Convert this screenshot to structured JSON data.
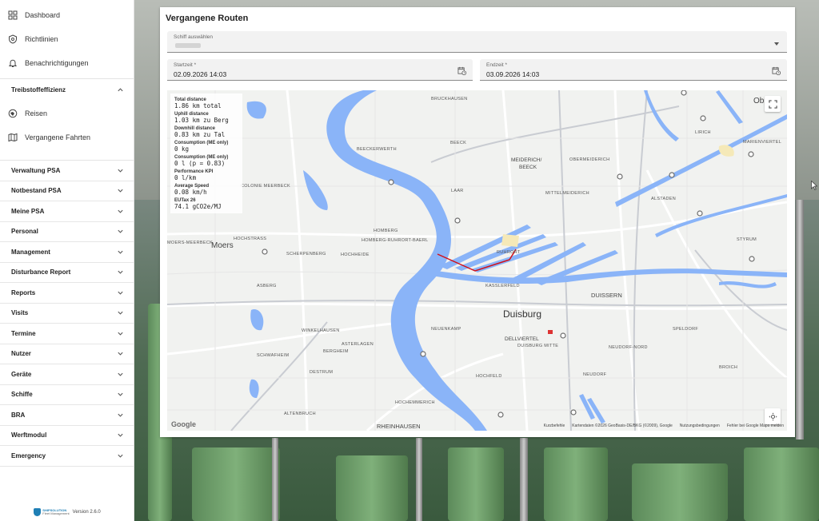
{
  "sidebar": {
    "top_items": [
      {
        "label": "Dashboard",
        "icon": "dashboard-icon"
      },
      {
        "label": "Richtlinien",
        "icon": "policy-icon"
      },
      {
        "label": "Benachrichtigungen",
        "icon": "bell-icon"
      }
    ],
    "section": {
      "title": "Treibstoffeffizienz",
      "expanded": true,
      "items": [
        {
          "label": "Reisen",
          "icon": "travel-icon"
        },
        {
          "label": "Vergangene Fahrten",
          "icon": "map-icon"
        }
      ]
    },
    "groups": [
      "Verwaltung PSA",
      "Notbestand PSA",
      "Meine PSA",
      "Personal",
      "Management",
      "Disturbance Report",
      "Reports",
      "Visits",
      "Termine",
      "Nutzer",
      "Geräte",
      "Schiffe",
      "BRA",
      "Werftmodul",
      "Emergency"
    ],
    "footer": {
      "logo_text": "SHIPSOLUTION",
      "logo_sub": "Fleet Management",
      "version": "Version 2.6.0"
    }
  },
  "main": {
    "title": "Vergangene Routen",
    "ship_select": {
      "label": "Schiff auswählen",
      "value": ""
    },
    "start": {
      "label": "Startzeit *",
      "value": "02.09.2026 14:03"
    },
    "end": {
      "label": "Endzeit *",
      "value": "03.09.2026 14:03"
    }
  },
  "stats": [
    {
      "label": "Total distance",
      "value": "1.86 km total"
    },
    {
      "label": "Uphill distance",
      "value": "1.03 km zu Berg"
    },
    {
      "label": "Downhill distance",
      "value": "0.83 km zu Tal"
    },
    {
      "label": "Consumption (ME only)",
      "value": "0 kg"
    },
    {
      "label": "Consumption (ME only)",
      "value": "0 l (p = 0.83)"
    },
    {
      "label": "Performance KPI",
      "value": "0 l/km"
    },
    {
      "label": "Average Speed",
      "value": "0.08 km/h"
    },
    {
      "label": "EUTax 26",
      "value": "74.1 gCO2e/MJ"
    }
  ],
  "map": {
    "city": "Duisburg",
    "towns": {
      "moers": "Moers",
      "rheinhausen": "RHEINHAUSEN",
      "duissern": "DUISSERN",
      "meiderich": "MEIDERICH/",
      "beeck": "BEECK",
      "dellviertel": "DELLVIERTEL",
      "ob": "Ob"
    },
    "places": [
      "BRUCKHAUSEN",
      "BEECKERWERTH",
      "BEECK",
      "LIRICH",
      "MARIENVIERTEL",
      "OBERMEIDERICH",
      "MITTELMEIDERICH",
      "ALSTADEN",
      "HOMBERG",
      "HOMBERG-RUHRORT-BAERL",
      "HOCHHEIDE",
      "SCHERPENBERG",
      "HOCHSTRASS",
      "MOERS-MEERBECK",
      "COLONIE MEERBECK",
      "LAAR",
      "RUHRORT",
      "KASSLERFELD",
      "ASBERG",
      "WINKELHAUSEN",
      "ASTERLAGEN",
      "BERGHEIM",
      "SCHWAFHEIM",
      "DESTRUM",
      "NEUENKAMP",
      "DUISBURG MITTE",
      "HOCHFELD",
      "NEUDORF",
      "NEUDORF-NORD",
      "SPELDORF",
      "BROICH",
      "HOCHEMMERICH",
      "ALTENBRUCH",
      "STYRUM"
    ],
    "google": "Google",
    "attribution": [
      "Kurzbefehle",
      "Kartendaten ©2026 GeoBasis-DE/BKG (©2009), Google",
      "Nutzungsbedingungen",
      "Fehler bei Google Maps melden"
    ],
    "route_color": "#d0101a",
    "water_color": "#8ab4f8"
  }
}
